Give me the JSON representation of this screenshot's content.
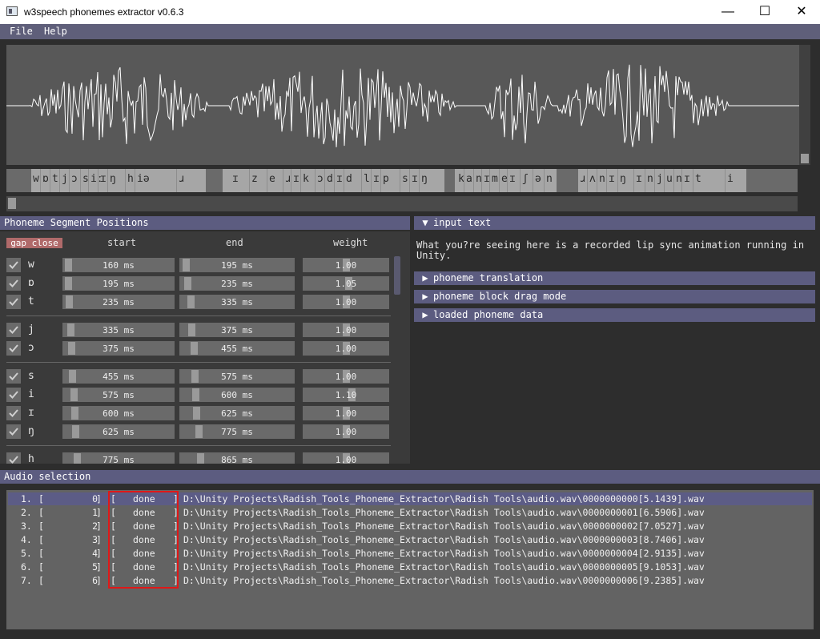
{
  "window": {
    "title": "w3speech phonemes extractor v0.6.3",
    "controls": {
      "minimize": "—",
      "maximize": "☐",
      "close": "✕"
    }
  },
  "menu": {
    "file": "File",
    "help": "Help"
  },
  "phoneme_strip": {
    "segments": [
      {
        "symbols": [
          "w",
          "ɒ",
          "t",
          "j",
          "ɔ",
          "s",
          "iː",
          "ɪ",
          "ŋ",
          "h",
          "iə",
          "ɹ"
        ]
      },
      {
        "symbols": [
          "ɪ",
          "z",
          "e",
          "ɹ",
          "ɪ",
          "k",
          "ɔ",
          "d",
          "ɪ",
          "d",
          "l",
          "ɪ",
          "p",
          "s",
          "ɪ",
          "ŋ"
        ]
      },
      {
        "symbols": [
          "k",
          "a",
          "n",
          "ɪ",
          "m",
          "e",
          "ɪ",
          "ʃ",
          "ə",
          "n"
        ]
      },
      {
        "symbols": [
          "ɹ",
          "ʌ",
          "n",
          "ɪ",
          "ŋ",
          "ɪ",
          "n",
          "j",
          "u",
          "n",
          "ɪ",
          "t",
          "i"
        ]
      }
    ]
  },
  "segments_panel": {
    "title": "Phoneme Segment Positions",
    "gap_close": "gap close",
    "col_start": "start",
    "col_end": "end",
    "col_weight": "weight",
    "rows": [
      {
        "phoneme": "w",
        "start": "160 ms",
        "end": "195 ms",
        "weight": "1.00"
      },
      {
        "phoneme": "ɒ",
        "start": "195 ms",
        "end": "235 ms",
        "weight": "1.05"
      },
      {
        "phoneme": "t",
        "start": "235 ms",
        "end": "335 ms",
        "weight": "1.00"
      },
      {
        "phoneme": "j",
        "start": "335 ms",
        "end": "375 ms",
        "weight": "1.00"
      },
      {
        "phoneme": "ɔ",
        "start": "375 ms",
        "end": "455 ms",
        "weight": "1.00"
      },
      {
        "phoneme": "s",
        "start": "455 ms",
        "end": "575 ms",
        "weight": "1.00"
      },
      {
        "phoneme": "i",
        "start": "575 ms",
        "end": "600 ms",
        "weight": "1.10"
      },
      {
        "phoneme": "ɪ",
        "start": "600 ms",
        "end": "625 ms",
        "weight": "1.00"
      },
      {
        "phoneme": "ŋ",
        "start": "625 ms",
        "end": "775 ms",
        "weight": "1.00"
      },
      {
        "phoneme": "h",
        "start": "775 ms",
        "end": "865 ms",
        "weight": "1.00"
      }
    ]
  },
  "right_panel": {
    "input_text_header": "input text",
    "input_text": "What you?re seeing here is a recorded lip sync animation running in\nUnity.",
    "phoneme_translation": "phoneme translation",
    "block_drag_mode": "phoneme block drag mode",
    "loaded_data": "loaded phoneme data"
  },
  "audio": {
    "title": "Audio selection",
    "rows": [
      {
        "num": "1.",
        "index": "0",
        "status": "done",
        "path": "D:\\Unity Projects\\Radish_Tools_Phoneme_Extractor\\Radish Tools\\audio.wav\\0000000000[5.1439].wav"
      },
      {
        "num": "2.",
        "index": "1",
        "status": "done",
        "path": "D:\\Unity Projects\\Radish_Tools_Phoneme_Extractor\\Radish Tools\\audio.wav\\0000000001[6.5906].wav"
      },
      {
        "num": "3.",
        "index": "2",
        "status": "done",
        "path": "D:\\Unity Projects\\Radish_Tools_Phoneme_Extractor\\Radish Tools\\audio.wav\\0000000002[7.0527].wav"
      },
      {
        "num": "4.",
        "index": "3",
        "status": "done",
        "path": "D:\\Unity Projects\\Radish_Tools_Phoneme_Extractor\\Radish Tools\\audio.wav\\0000000003[8.7406].wav"
      },
      {
        "num": "5.",
        "index": "4",
        "status": "done",
        "path": "D:\\Unity Projects\\Radish_Tools_Phoneme_Extractor\\Radish Tools\\audio.wav\\0000000004[2.9135].wav"
      },
      {
        "num": "6.",
        "index": "5",
        "status": "done",
        "path": "D:\\Unity Projects\\Radish_Tools_Phoneme_Extractor\\Radish Tools\\audio.wav\\0000000005[9.1053].wav"
      },
      {
        "num": "7.",
        "index": "6",
        "status": "done",
        "path": "D:\\Unity Projects\\Radish_Tools_Phoneme_Extractor\\Radish Tools\\audio.wav\\0000000006[9.2385].wav"
      }
    ]
  },
  "colors": {
    "header": "#5c5c80",
    "highlight": "#e01818",
    "panel": "#3a3a3a"
  }
}
